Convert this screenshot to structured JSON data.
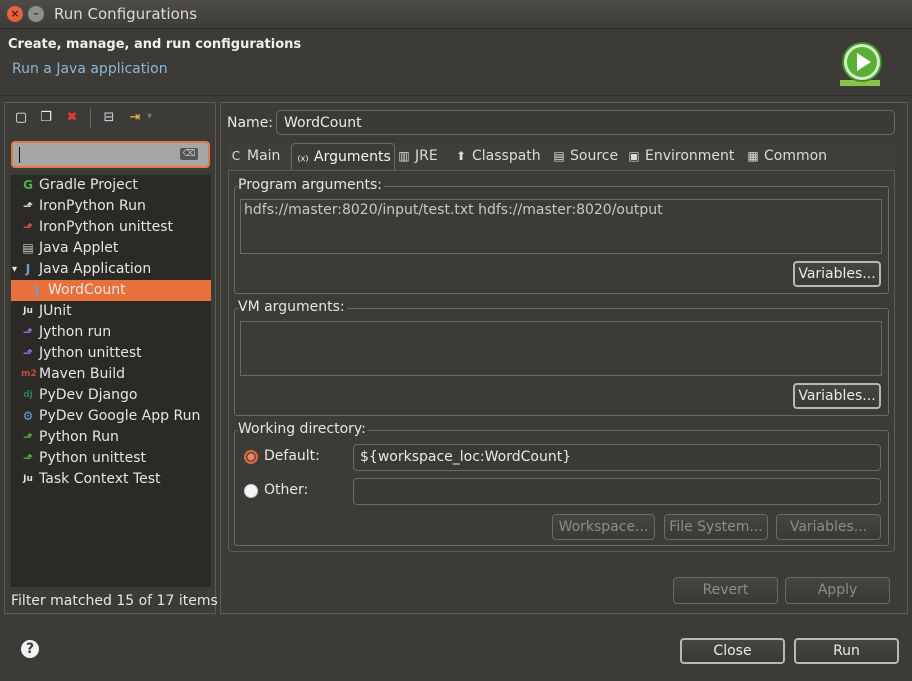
{
  "window": {
    "title": "Run Configurations",
    "close_glyph": "×",
    "minimize_glyph": "–"
  },
  "header": {
    "title": "Create, manage, and run configurations",
    "subtitle": "Run a Java application",
    "logo_icon": "run-play-icon"
  },
  "toolbar": {
    "icons": [
      "new-config-icon",
      "duplicate-icon",
      "delete-icon",
      "collapse-all-icon",
      "filter-icon"
    ],
    "glyphs": {
      "new": "▢",
      "duplicate": "❐",
      "delete": "✖",
      "collapse": "⊟",
      "filter": "⇥",
      "clear": "⌫"
    }
  },
  "filter": {
    "value": "",
    "status": "Filter matched 15 of 17 items"
  },
  "tree": {
    "items": [
      {
        "label": "Gradle Project",
        "icon": "gradle-icon",
        "glyph": "G",
        "color": "#4caf50"
      },
      {
        "label": "IronPython Run",
        "icon": "ironpython-run-icon",
        "glyph": "⬏",
        "color": "#dddddd"
      },
      {
        "label": "IronPython unittest",
        "icon": "ironpython-unittest-icon",
        "glyph": "⬏",
        "color": "#e05050"
      },
      {
        "label": "Java Applet",
        "icon": "java-applet-icon",
        "glyph": "▤",
        "color": "#cfcfcf"
      },
      {
        "label": "Java Application",
        "icon": "java-application-icon",
        "glyph": "J",
        "color": "#6a9fd8",
        "expander": "▾"
      },
      {
        "label": "WordCount",
        "icon": "java-class-icon",
        "glyph": "J",
        "color": "#6a9fd8",
        "selected": true
      },
      {
        "label": "JUnit",
        "icon": "junit-icon",
        "glyph": "Ju",
        "color": "#dddddd"
      },
      {
        "label": "Jython run",
        "icon": "jython-run-icon",
        "glyph": "⬏",
        "color": "#9b6bd8"
      },
      {
        "label": "Jython unittest",
        "icon": "jython-unittest-icon",
        "glyph": "⬏",
        "color": "#9b6bd8"
      },
      {
        "label": "Maven Build",
        "icon": "maven-icon",
        "glyph": "m2",
        "color": "#c94a3a"
      },
      {
        "label": "PyDev Django",
        "icon": "django-icon",
        "glyph": "dj",
        "color": "#2f7d4f"
      },
      {
        "label": "PyDev Google App Run",
        "icon": "google-app-icon",
        "glyph": "⚙",
        "color": "#6a9fd8"
      },
      {
        "label": "Python Run",
        "icon": "python-run-icon",
        "glyph": "⬏",
        "color": "#4caf50"
      },
      {
        "label": "Python unittest",
        "icon": "python-unittest-icon",
        "glyph": "⬏",
        "color": "#4caf50"
      },
      {
        "label": "Task Context Test",
        "icon": "task-context-icon",
        "glyph": "Ju",
        "color": "#dddddd"
      }
    ]
  },
  "config": {
    "name_label": "Name:",
    "name_value": "WordCount",
    "tabs": [
      {
        "label": "Main",
        "icon": "main-tab-icon",
        "glyph": "C"
      },
      {
        "label": "Arguments",
        "icon": "arguments-tab-icon",
        "glyph": "(x)",
        "active": true
      },
      {
        "label": "JRE",
        "icon": "jre-tab-icon",
        "glyph": "▥"
      },
      {
        "label": "Classpath",
        "icon": "classpath-tab-icon",
        "glyph": "⬆"
      },
      {
        "label": "Source",
        "icon": "source-tab-icon",
        "glyph": "▤"
      },
      {
        "label": "Environment",
        "icon": "environment-tab-icon",
        "glyph": "▣"
      },
      {
        "label": "Common",
        "icon": "common-tab-icon",
        "glyph": "▦"
      }
    ],
    "program_args": {
      "label": "Program arguments:",
      "value": "hdfs://master:8020/input/test.txt hdfs://master:8020/output",
      "variables_label": "Variables..."
    },
    "vm_args": {
      "label": "VM arguments:",
      "value": "",
      "variables_label": "Variables..."
    },
    "working_dir": {
      "label": "Working directory:",
      "default_label": "Default:",
      "default_value": "${workspace_loc:WordCount}",
      "default_selected": true,
      "other_label": "Other:",
      "other_value": "",
      "workspace_label": "Workspace...",
      "filesystem_label": "File System...",
      "variables_label": "Variables..."
    },
    "revert_label": "Revert",
    "apply_label": "Apply"
  },
  "footer": {
    "help_glyph": "?",
    "close_label": "Close",
    "run_label": "Run"
  }
}
